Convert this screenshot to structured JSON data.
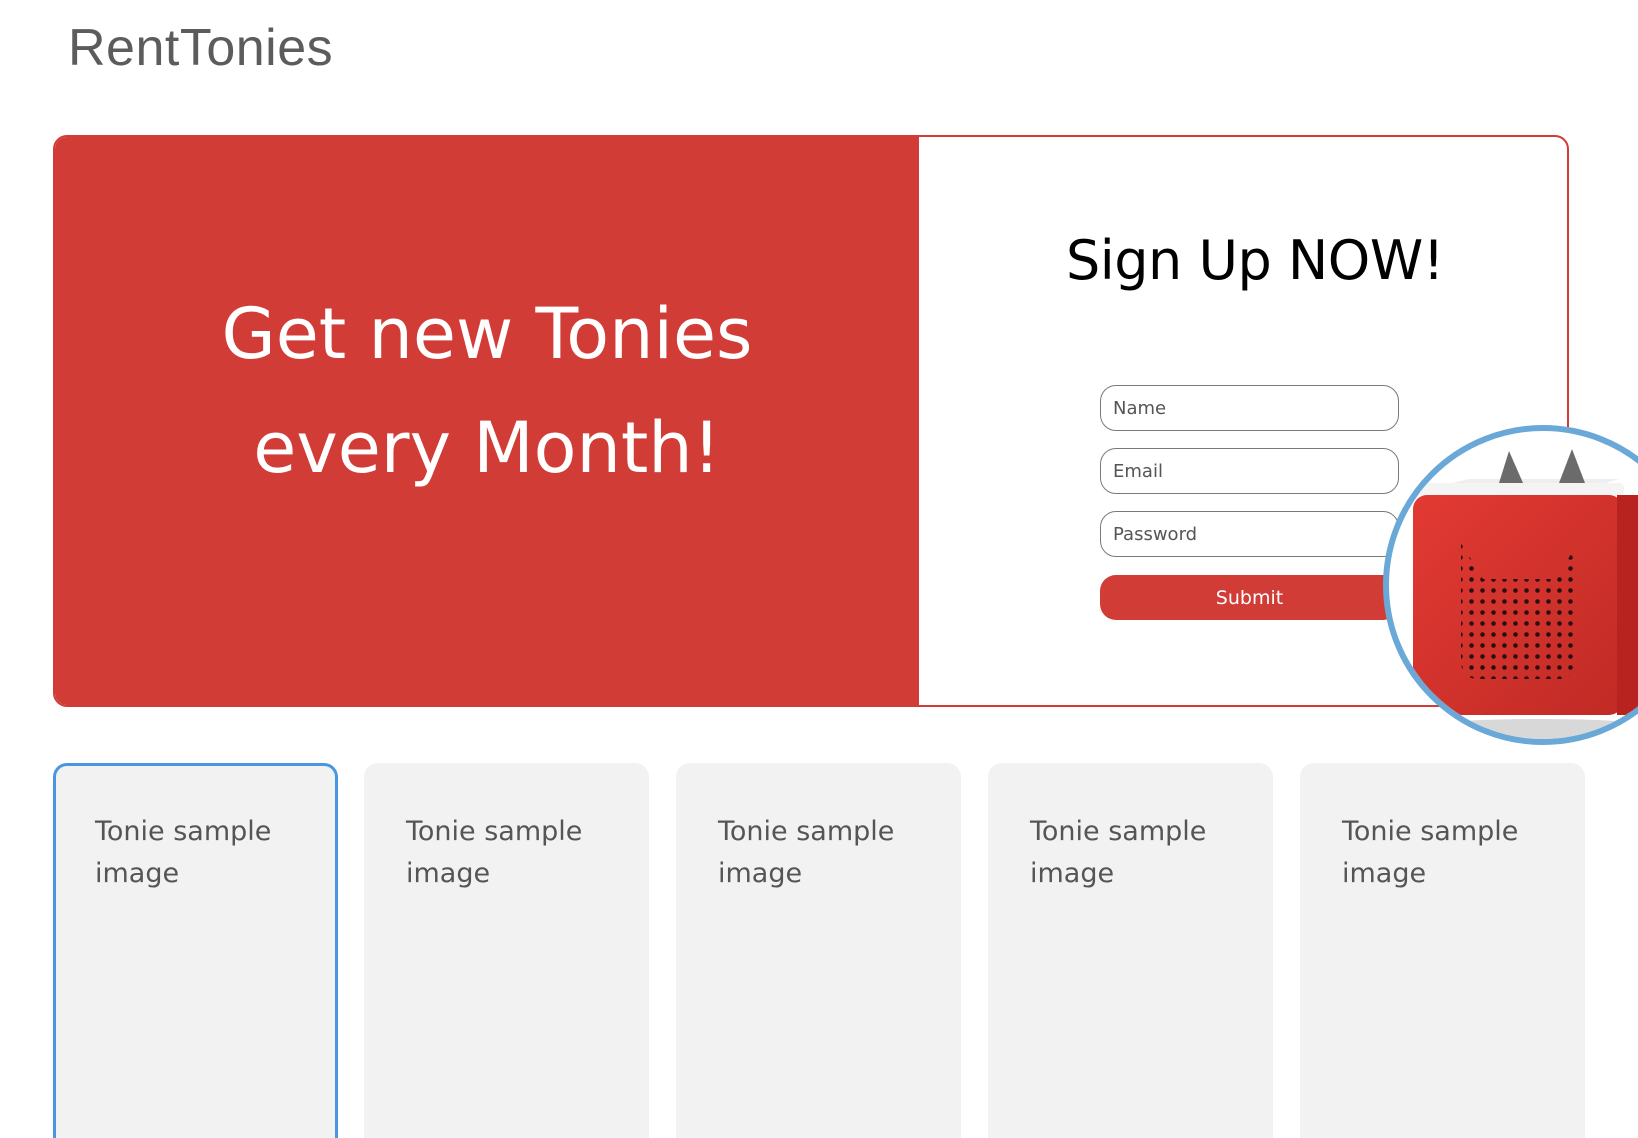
{
  "header": {
    "logo_text": "RentTonies"
  },
  "hero": {
    "tagline": "Get new Tonies every Month!",
    "accent_color": "#d13c37"
  },
  "signup": {
    "title": "Sign Up NOW!",
    "name_placeholder": "Name",
    "email_placeholder": "Email",
    "password_placeholder": "Password",
    "submit_label": "Submit"
  },
  "product": {
    "image_icon": "toniebox-speaker-image",
    "ring_color": "#6aa8d8"
  },
  "cards": [
    {
      "label": "Tonie sample image",
      "selected": true
    },
    {
      "label": "Tonie sample image",
      "selected": false
    },
    {
      "label": "Tonie sample image",
      "selected": false
    },
    {
      "label": "Tonie sample image",
      "selected": false
    },
    {
      "label": "Tonie sample image",
      "selected": false
    }
  ]
}
